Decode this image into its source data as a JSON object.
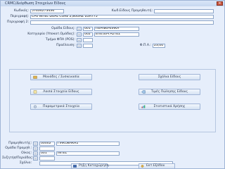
{
  "window": {
    "title": "CRMC/Διόρθωση Στοιχείων Είδους"
  },
  "fields": {
    "code_label": "Κωδικός:",
    "code_value": "57634273436",
    "supplier_code_label": "Κωδ.Είδους Προμηθευτή:",
    "description_label": "Περιγραφή:",
    "description_value": "CPU INTEL DUAL CORE 2,80GHZ LGA775",
    "description2_label": "Περιγραφή 2:",
    "group_label": "Ομάδα Είδους:",
    "group_code": "001",
    "group_name": "ΠΕΡΙΦΕΡΕΙΑΚΑ",
    "category_label": "Κατηγορία (Υποκατ.Ομάδας):",
    "category_code": "002",
    "category_name": "ΕΠΕΞΕΡΓΑΣΤΕΣ",
    "vat_group_label": "Τμήμα ΦΠΑ (POS):",
    "origin_label": "Προέλευση:",
    "vat_rate_label": "Φ.Π.Α.:",
    "vat_rate_value": "23,00"
  },
  "actions": {
    "units": "Μονάδες / Συσκευασία",
    "item_notes": "Σχόλια Είδους",
    "other_details": "Λοιπά Στοιχεία Είδους",
    "sale_prices": "Τιμές Πώλησης Είδους",
    "parametric": "Παραμετρικά Στοιχεία",
    "statistics": "Στατιστικά Χρήσης"
  },
  "lower": {
    "supplier_label": "Προμηθευτής:",
    "supplier_code": "00002",
    "supplier_name": "ΓΙΑΚΟΒΑΚΗΣ",
    "supplier_group_label": "Ομάδα Προμηθ.:",
    "brand_label": "Οίκος:",
    "brand_code": "001",
    "brand_name": "INTEL",
    "packaging_label": "Συζητήσ/Περιόδος:",
    "notes_label": "Σχόλια:"
  },
  "footer": {
    "save": "Ρηξη Καταχώρηση",
    "exit": "Εκτ.Εξόδου"
  },
  "colors": {
    "window_bg": "#e6eefb",
    "accent_border": "#9fb4d6"
  }
}
